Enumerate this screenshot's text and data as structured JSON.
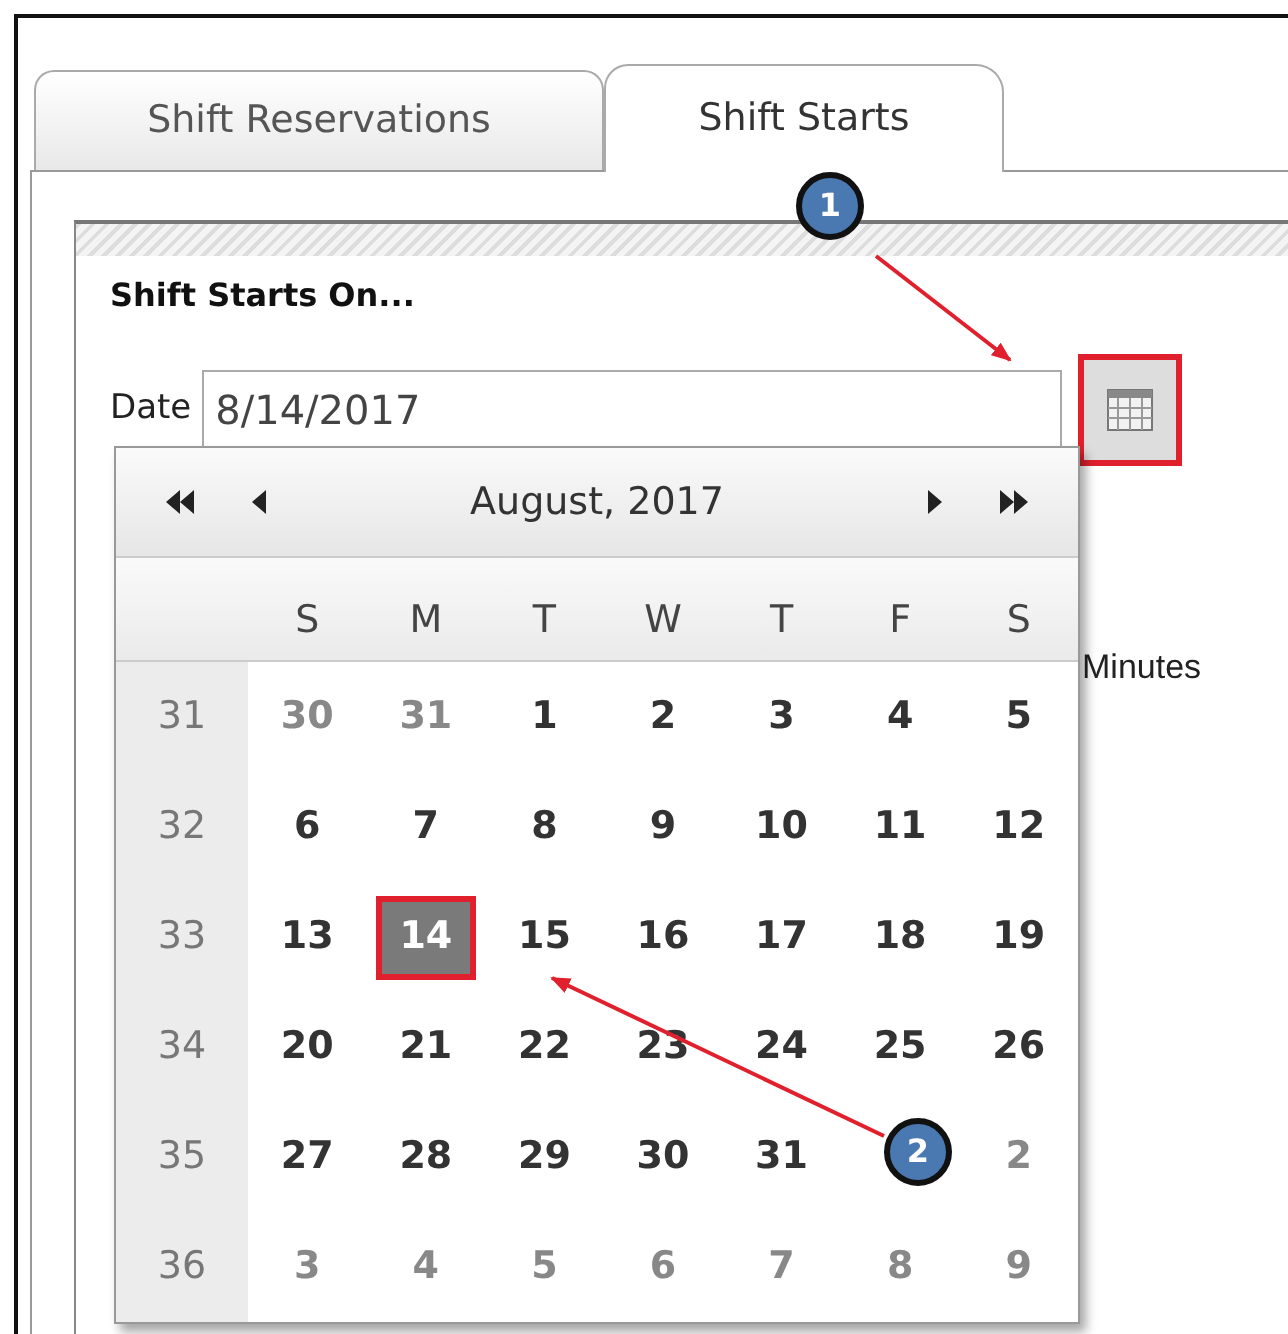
{
  "tabs": [
    {
      "label": "Shift Reservations",
      "selected": false
    },
    {
      "label": "Shift Starts",
      "selected": true
    }
  ],
  "section": {
    "title": "Shift Starts On...",
    "date_label": "Date",
    "date_value": "8/14/2017",
    "behind_text": "Minutes"
  },
  "calendar": {
    "month_title": "August, 2017",
    "weekdays": [
      "S",
      "M",
      "T",
      "W",
      "T",
      "F",
      "S"
    ],
    "weeks": [
      {
        "number": "31",
        "days": [
          {
            "text": "30",
            "kind": "other",
            "selected": false
          },
          {
            "text": "31",
            "kind": "other",
            "selected": false
          },
          {
            "text": "1",
            "kind": "current",
            "selected": false
          },
          {
            "text": "2",
            "kind": "current",
            "selected": false
          },
          {
            "text": "3",
            "kind": "current",
            "selected": false
          },
          {
            "text": "4",
            "kind": "current",
            "selected": false
          },
          {
            "text": "5",
            "kind": "current",
            "selected": false
          }
        ]
      },
      {
        "number": "32",
        "days": [
          {
            "text": "6",
            "kind": "current",
            "selected": false
          },
          {
            "text": "7",
            "kind": "current",
            "selected": false
          },
          {
            "text": "8",
            "kind": "current",
            "selected": false
          },
          {
            "text": "9",
            "kind": "current",
            "selected": false
          },
          {
            "text": "10",
            "kind": "current",
            "selected": false
          },
          {
            "text": "11",
            "kind": "current",
            "selected": false
          },
          {
            "text": "12",
            "kind": "current",
            "selected": false
          }
        ]
      },
      {
        "number": "33",
        "days": [
          {
            "text": "13",
            "kind": "current",
            "selected": false
          },
          {
            "text": "14",
            "kind": "current",
            "selected": true
          },
          {
            "text": "15",
            "kind": "current",
            "selected": false
          },
          {
            "text": "16",
            "kind": "current",
            "selected": false
          },
          {
            "text": "17",
            "kind": "current",
            "selected": false
          },
          {
            "text": "18",
            "kind": "current",
            "selected": false
          },
          {
            "text": "19",
            "kind": "current",
            "selected": false
          }
        ]
      },
      {
        "number": "34",
        "days": [
          {
            "text": "20",
            "kind": "current",
            "selected": false
          },
          {
            "text": "21",
            "kind": "current",
            "selected": false
          },
          {
            "text": "22",
            "kind": "current",
            "selected": false
          },
          {
            "text": "23",
            "kind": "current",
            "selected": false
          },
          {
            "text": "24",
            "kind": "current",
            "selected": false
          },
          {
            "text": "25",
            "kind": "current",
            "selected": false
          },
          {
            "text": "26",
            "kind": "current",
            "selected": false
          }
        ]
      },
      {
        "number": "35",
        "days": [
          {
            "text": "27",
            "kind": "current",
            "selected": false
          },
          {
            "text": "28",
            "kind": "current",
            "selected": false
          },
          {
            "text": "29",
            "kind": "current",
            "selected": false
          },
          {
            "text": "30",
            "kind": "current",
            "selected": false
          },
          {
            "text": "31",
            "kind": "current",
            "selected": false
          },
          {
            "kind": "covered"
          },
          {
            "text": "2",
            "kind": "other",
            "selected": false
          }
        ]
      },
      {
        "number": "36",
        "days": [
          {
            "text": "3",
            "kind": "other",
            "selected": false
          },
          {
            "text": "4",
            "kind": "other",
            "selected": false
          },
          {
            "text": "5",
            "kind": "other",
            "selected": false
          },
          {
            "text": "6",
            "kind": "other",
            "selected": false
          },
          {
            "text": "7",
            "kind": "other",
            "selected": false
          },
          {
            "text": "8",
            "kind": "other",
            "selected": false
          },
          {
            "text": "9",
            "kind": "other",
            "selected": false
          }
        ]
      }
    ]
  },
  "callouts": [
    {
      "label": "1"
    },
    {
      "label": "2"
    }
  ]
}
